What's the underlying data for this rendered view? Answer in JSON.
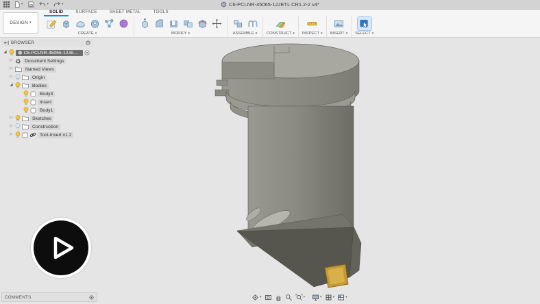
{
  "colors": {
    "accent_blue": "#0696d7",
    "select_active_blue": "#2e77c0",
    "insert_gold": "#c49a33",
    "canvas_background": "#e5e5e6"
  },
  "app_bar": {
    "title": "C6-PCLNR-45065-12JETL CR1.2-2 v4*",
    "icons": [
      "data-panel-grid-icon",
      "file-icon",
      "save-icon",
      "undo-icon",
      "redo-icon",
      "document-cube-icon"
    ]
  },
  "workspace_button": {
    "label": "DESIGN"
  },
  "tabs": [
    {
      "label": "SOLID",
      "active": true
    },
    {
      "label": "SURFACE",
      "active": false
    },
    {
      "label": "SHEET METAL",
      "active": false
    },
    {
      "label": "TOOLS",
      "active": false
    }
  ],
  "toolbar": {
    "groups": [
      {
        "label": "CREATE",
        "icons": [
          "create-sketch-icon",
          "extrude-icon",
          "revolve-icon",
          "sweep-icon",
          "pipe-icon",
          "form-icon"
        ]
      },
      {
        "label": "MODIFY",
        "icons": [
          "press-pull-icon",
          "fillet-icon",
          "shell-icon",
          "combine-icon",
          "split-body-icon",
          "move-copy-icon"
        ]
      },
      {
        "label": "ASSEMBLE",
        "icons": [
          "new-component-icon",
          "joint-icon"
        ]
      },
      {
        "label": "CONSTRUCT",
        "icons": [
          "construction-plane-icon"
        ]
      },
      {
        "label": "INSPECT",
        "icons": [
          "measure-icon"
        ]
      },
      {
        "label": "INSERT",
        "icons": [
          "insert-image-icon"
        ]
      },
      {
        "label": "SELECT",
        "icons": [
          "select-icon"
        ],
        "active": true
      }
    ]
  },
  "browser": {
    "header": "BROWSER",
    "items": [
      {
        "label": "C6-PCLNR-45065-12JETL CR1...",
        "level": 0,
        "expanded": true,
        "bulb": "on",
        "icon": "component-icon",
        "selected": true
      },
      {
        "label": "Document Settings",
        "level": 1,
        "expanded": false,
        "bulb": null,
        "icon": "gear-icon"
      },
      {
        "label": "Named Views",
        "level": 1,
        "expanded": false,
        "bulb": null,
        "icon": "folder-icon"
      },
      {
        "label": "Origin",
        "level": 1,
        "expanded": false,
        "bulb": "off",
        "icon": "folder-icon"
      },
      {
        "label": "Bodies",
        "level": 1,
        "expanded": true,
        "bulb": "on",
        "icon": "folder-icon"
      },
      {
        "label": "Body3",
        "level": 2,
        "expanded": false,
        "bulb": "on",
        "icon": "body-icon"
      },
      {
        "label": "Insert",
        "level": 2,
        "expanded": false,
        "bulb": "on",
        "icon": "body-icon"
      },
      {
        "label": "Body1",
        "level": 2,
        "expanded": false,
        "bulb": "on",
        "icon": "body-icon"
      },
      {
        "label": "Sketches",
        "level": 1,
        "expanded": false,
        "bulb": "on",
        "icon": "folder-icon"
      },
      {
        "label": "Construction",
        "level": 1,
        "expanded": false,
        "bulb": "off",
        "icon": "folder-icon"
      },
      {
        "label": "Tool-Insert v1.2",
        "level": 1,
        "expanded": false,
        "bulb": "on",
        "icon": "linked-component-icon"
      }
    ]
  },
  "comments_bar": {
    "label": "COMMENTS"
  },
  "nav_bar": {
    "icons": [
      "orbit-icon",
      "look-at-icon",
      "pan-icon",
      "zoom-icon",
      "fit-icon",
      "display-settings-icon",
      "grid-snaps-icon",
      "viewports-icon"
    ]
  },
  "overlay": {
    "play_button_icon": "play-icon"
  }
}
